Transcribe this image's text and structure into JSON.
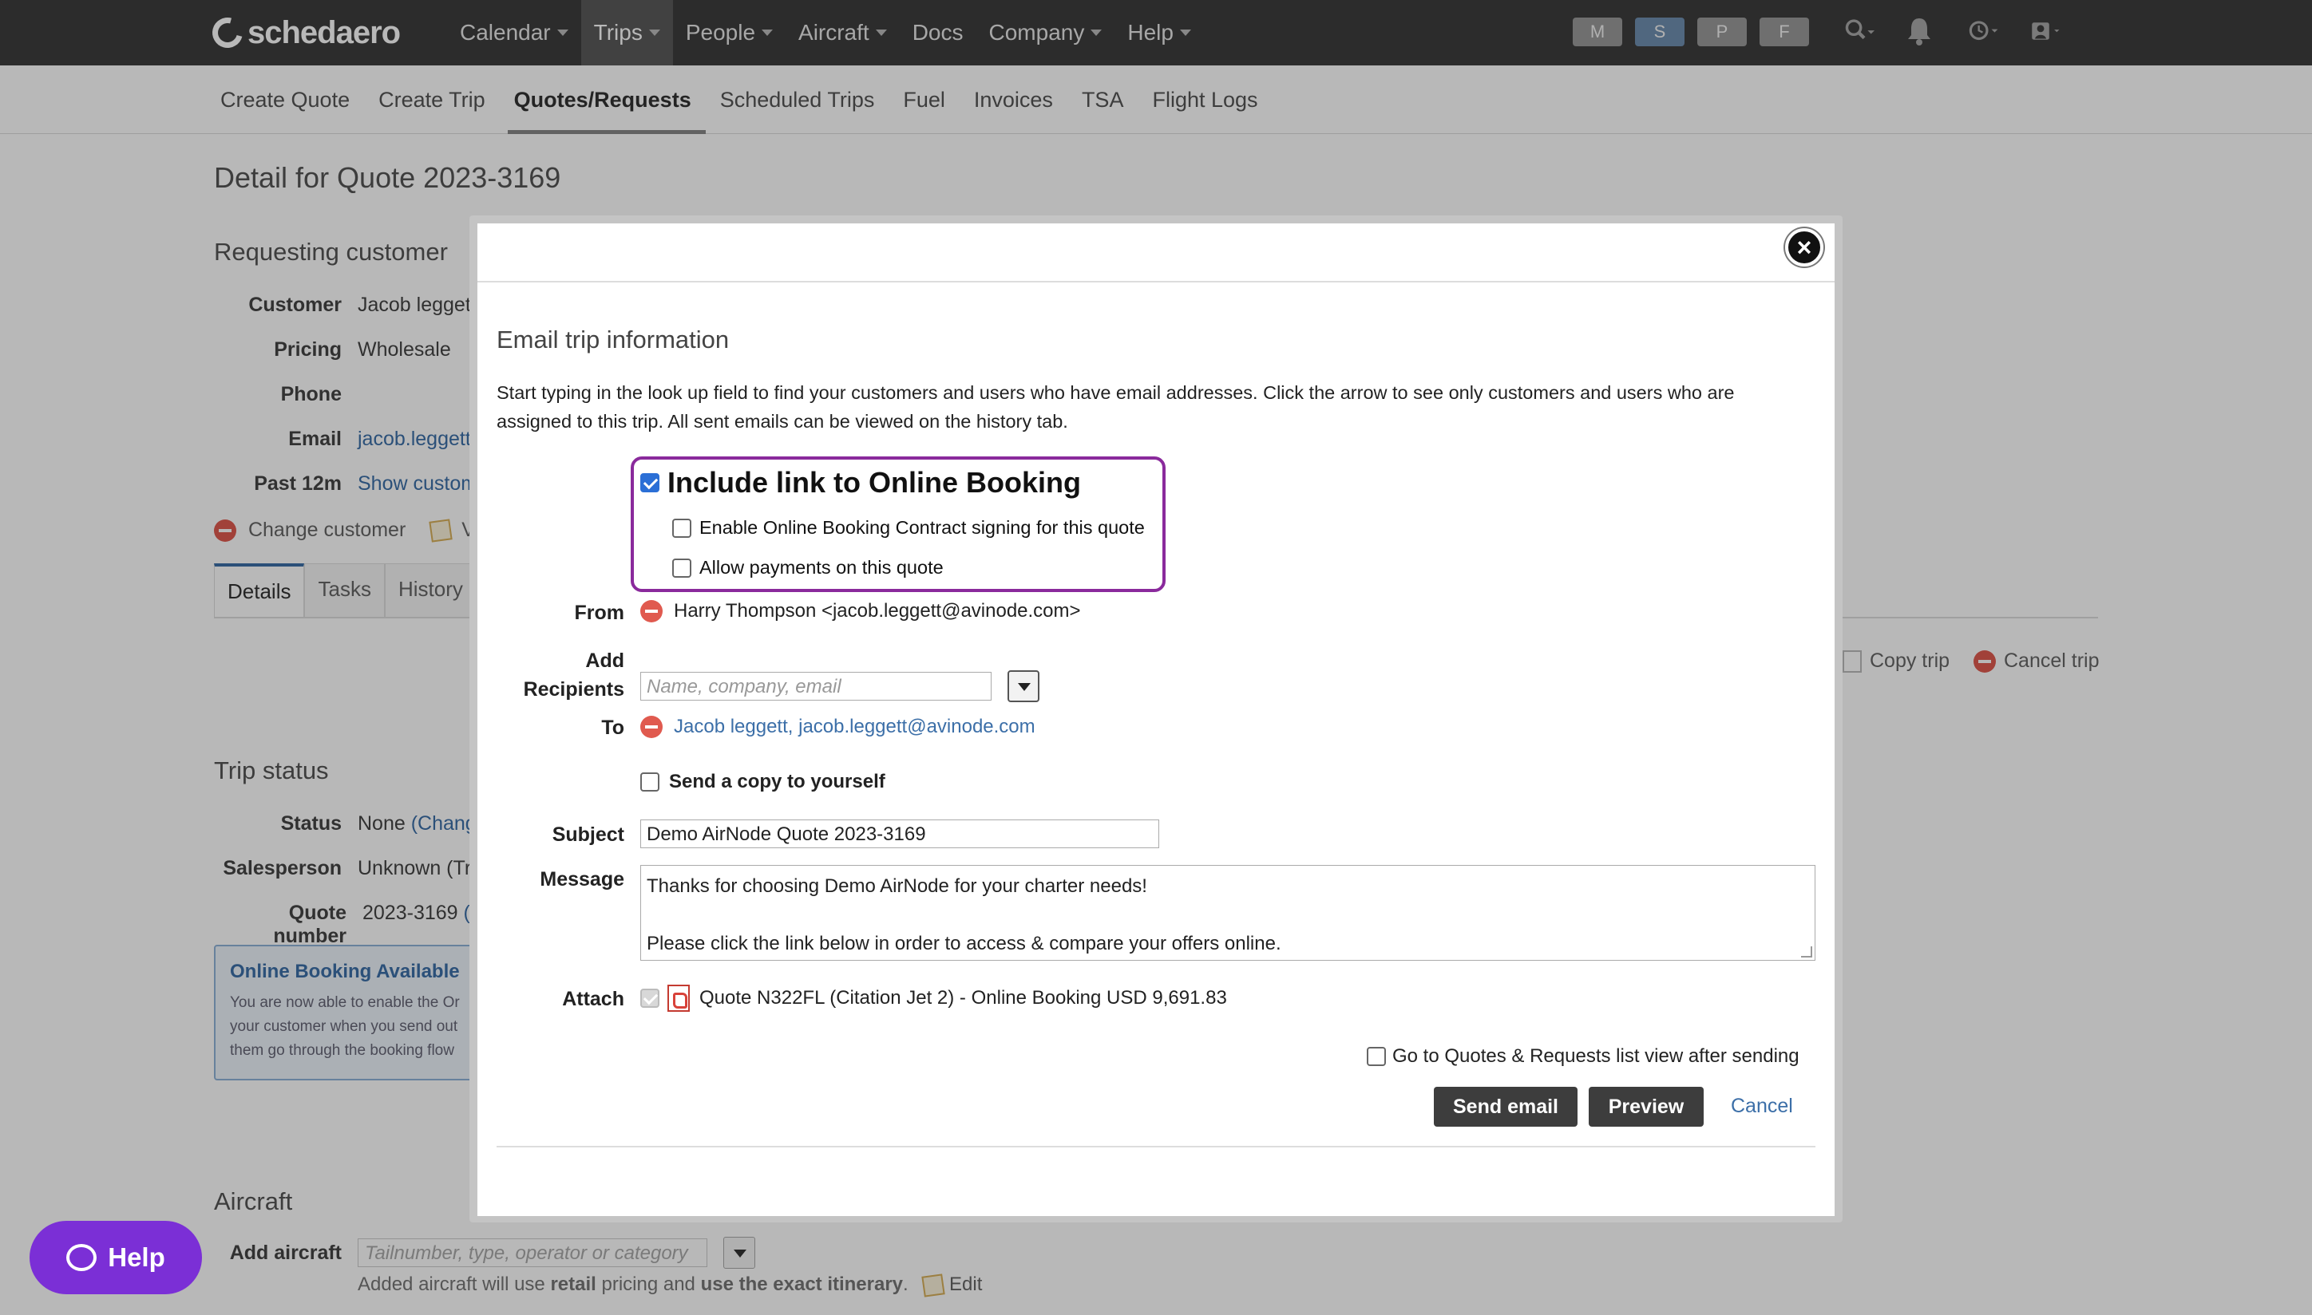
{
  "app": {
    "name": "schedaero"
  },
  "topnav": {
    "items": [
      {
        "label": "Calendar",
        "dropdown": true
      },
      {
        "label": "Trips",
        "dropdown": true,
        "active": true
      },
      {
        "label": "People",
        "dropdown": true
      },
      {
        "label": "Aircraft",
        "dropdown": true
      },
      {
        "label": "Docs",
        "dropdown": false
      },
      {
        "label": "Company",
        "dropdown": true
      },
      {
        "label": "Help",
        "dropdown": true
      }
    ],
    "mode_pills": [
      "M",
      "S",
      "P",
      "F"
    ]
  },
  "subnav": {
    "items": [
      "Create Quote",
      "Create Trip",
      "Quotes/Requests",
      "Scheduled Trips",
      "Fuel",
      "Invoices",
      "TSA",
      "Flight Logs"
    ],
    "active": "Quotes/Requests"
  },
  "page": {
    "title": "Detail for Quote 2023-3169",
    "requesting_customer": {
      "heading": "Requesting customer",
      "customer_label": "Customer",
      "customer_value": "Jacob leggett",
      "pricing_label": "Pricing",
      "pricing_value": "Wholesale",
      "phone_label": "Phone",
      "email_label": "Email",
      "email_value": "jacob.leggett",
      "past_label": "Past 12m",
      "past_value": "Show custom",
      "change_customer": "Change customer",
      "view_partial": "Vie"
    },
    "tabs": [
      "Details",
      "Tasks",
      "History"
    ],
    "actions": {
      "copy_trip": "Copy trip",
      "cancel_trip": "Cancel trip"
    },
    "trip_status": {
      "heading": "Trip status",
      "status_label": "Status",
      "status_value": "None",
      "status_link": "(Chang",
      "salesperson_label": "Salesperson",
      "salesperson_value": "Unknown (Tri",
      "quote_number_label": "Quote number",
      "quote_number_value": "2023-3169",
      "quote_number_suffix": "("
    },
    "online_booking_box": {
      "title": "Online Booking Available",
      "line1": "You are now able to enable the Or",
      "line2": "your customer when you send out",
      "line3": "them go through the booking flow"
    },
    "aircraft": {
      "heading": "Aircraft",
      "add_label": "Add aircraft",
      "add_placeholder": "Tailnumber, type, operator or category",
      "note_pre": "Added aircraft will use ",
      "note_retail": "retail",
      "note_mid": " pricing and ",
      "note_exact": "use the exact itinerary",
      "note_end": ".",
      "edit": "Edit"
    }
  },
  "help_button": {
    "label": "Help"
  },
  "modal": {
    "title": "Email trip information",
    "description": "Start typing in the look up field to find your customers and users who have email addresses. Click the arrow to see only customers and users who are assigned to this trip. All sent emails can be viewed on the history tab.",
    "online_booking": {
      "include_label": "Include link to Online Booking",
      "include_checked": true,
      "contract_label": "Enable Online Booking Contract signing for this quote",
      "contract_checked": false,
      "payments_label": "Allow payments on this quote",
      "payments_checked": false
    },
    "from_label": "From",
    "from_value": "Harry Thompson <jacob.leggett@avinode.com>",
    "add_label": "Add",
    "recipients_label": "Recipients",
    "recipients_placeholder": "Name, company, email",
    "to_label": "To",
    "to_value": "Jacob leggett, jacob.leggett@avinode.com",
    "send_copy_label": "Send a copy to yourself",
    "send_copy_checked": false,
    "subject_label": "Subject",
    "subject_value": "Demo AirNode Quote 2023-3169",
    "message_label": "Message",
    "message_line1": "Thanks for choosing Demo AirNode for your charter needs!",
    "message_line2": "Please click the link below in order to access & compare your offers online.",
    "attach_label": "Attach",
    "attach_value": "Quote N322FL (Citation Jet 2) - Online Booking USD 9,691.83",
    "goto_label": "Go to Quotes & Requests list view after sending",
    "goto_checked": false,
    "send_email": "Send email",
    "preview": "Preview",
    "cancel": "Cancel"
  },
  "colors": {
    "accent": "#3c6fa8",
    "highlight_border": "#8a2a9c",
    "help_button": "#7b2fd6",
    "topbar": "#3d3d3d"
  }
}
